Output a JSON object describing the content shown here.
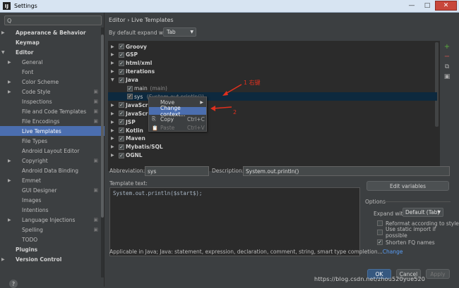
{
  "window": {
    "title": "Settings",
    "app_icon": "IJ",
    "min": "—",
    "max": "□",
    "close": "✕"
  },
  "search": {
    "icon": "Q",
    "value": ""
  },
  "sidebar": {
    "items": [
      {
        "label": "Appearance & Behavior",
        "bold": true,
        "arrow": "▶"
      },
      {
        "label": "Keymap",
        "bold": true
      },
      {
        "label": "Editor",
        "bold": true,
        "arrow": "▼"
      },
      {
        "label": "General",
        "arrow": "▶"
      },
      {
        "label": "Font"
      },
      {
        "label": "Color Scheme",
        "arrow": "▶"
      },
      {
        "label": "Code Style",
        "arrow": "▶",
        "cfg": true
      },
      {
        "label": "Inspections",
        "cfg": true
      },
      {
        "label": "File and Code Templates",
        "cfg": true
      },
      {
        "label": "File Encodings",
        "cfg": true
      },
      {
        "label": "Live Templates",
        "selected": true
      },
      {
        "label": "File Types"
      },
      {
        "label": "Android Layout Editor"
      },
      {
        "label": "Copyright",
        "arrow": "▶",
        "cfg": true
      },
      {
        "label": "Android Data Binding"
      },
      {
        "label": "Emmet",
        "arrow": "▶"
      },
      {
        "label": "GUI Designer",
        "cfg": true
      },
      {
        "label": "Images"
      },
      {
        "label": "Intentions"
      },
      {
        "label": "Language Injections",
        "arrow": "▶",
        "cfg": true
      },
      {
        "label": "Spelling",
        "cfg": true
      },
      {
        "label": "TODO"
      },
      {
        "label": "Plugins",
        "bold": true
      },
      {
        "label": "Version Control",
        "bold": true,
        "arrow": "▶"
      }
    ]
  },
  "help": "?",
  "breadcrumb": {
    "first": "Editor",
    "sep": "›",
    "second": "Live Templates"
  },
  "expand": {
    "label": "By default expand with",
    "value": "Tab"
  },
  "templates": {
    "rows": [
      {
        "label": "Groovy",
        "arrow": "▶"
      },
      {
        "label": "GSP",
        "arrow": "▶"
      },
      {
        "label": "html/xml",
        "arrow": "▶"
      },
      {
        "label": "iterations",
        "arrow": "▶"
      },
      {
        "label": "Java",
        "arrow": "▼"
      },
      {
        "label": "main",
        "sub": "(main)",
        "child": true
      },
      {
        "label": "sys",
        "sub": "(System.out.println())",
        "child": true,
        "selected": true
      },
      {
        "label": "JavaScript",
        "arrow": "▶"
      },
      {
        "label": "JavaScript",
        "arrow": "▶"
      },
      {
        "label": "JSP",
        "arrow": "▶"
      },
      {
        "label": "Kotlin",
        "arrow": "▶"
      },
      {
        "label": "Maven",
        "arrow": "▶"
      },
      {
        "label": "Mybatis/SQL",
        "arrow": "▶"
      },
      {
        "label": "OGNL",
        "arrow": "▶"
      }
    ]
  },
  "toolbar": {
    "add": "+",
    "remove": "−",
    "copy": "⧉",
    "restore": "▣"
  },
  "context_menu": {
    "items": [
      {
        "label": "Move",
        "submenu": "▶"
      },
      {
        "label": "Change context...",
        "selected": true
      },
      {
        "label": "Copy",
        "shortcut": "Ctrl+C",
        "icon": "⎘"
      },
      {
        "label": "Paste",
        "shortcut": "Ctrl+V",
        "icon": "📋",
        "disabled": true
      }
    ]
  },
  "annotations": {
    "note1": "1 右键",
    "note2": "2"
  },
  "abbreviation": {
    "label": "Abbreviation:",
    "value": "sys"
  },
  "description": {
    "label": "Description:",
    "value": "System.out.println()"
  },
  "template_text": {
    "label": "Template text:",
    "value": "System.out.println($start$);"
  },
  "edit_variables": "Edit variables",
  "options": {
    "title": "Options",
    "expand_label": "Expand with",
    "expand_value": "Default (Tab)",
    "checkboxes": [
      {
        "label": "Reformat according to style",
        "checked": false
      },
      {
        "label": "Use static import if possible",
        "checked": false
      },
      {
        "label": "Shorten FQ names",
        "checked": true
      }
    ]
  },
  "applicable": {
    "text": "Applicable in Java; Java: statement, expression, declaration, comment, string, smart type completion...",
    "link": "Change"
  },
  "buttons": {
    "ok": "OK",
    "cancel": "Cancel",
    "apply": "Apply"
  },
  "watermark": "https://blog.csdn.net/zhou520yue520"
}
